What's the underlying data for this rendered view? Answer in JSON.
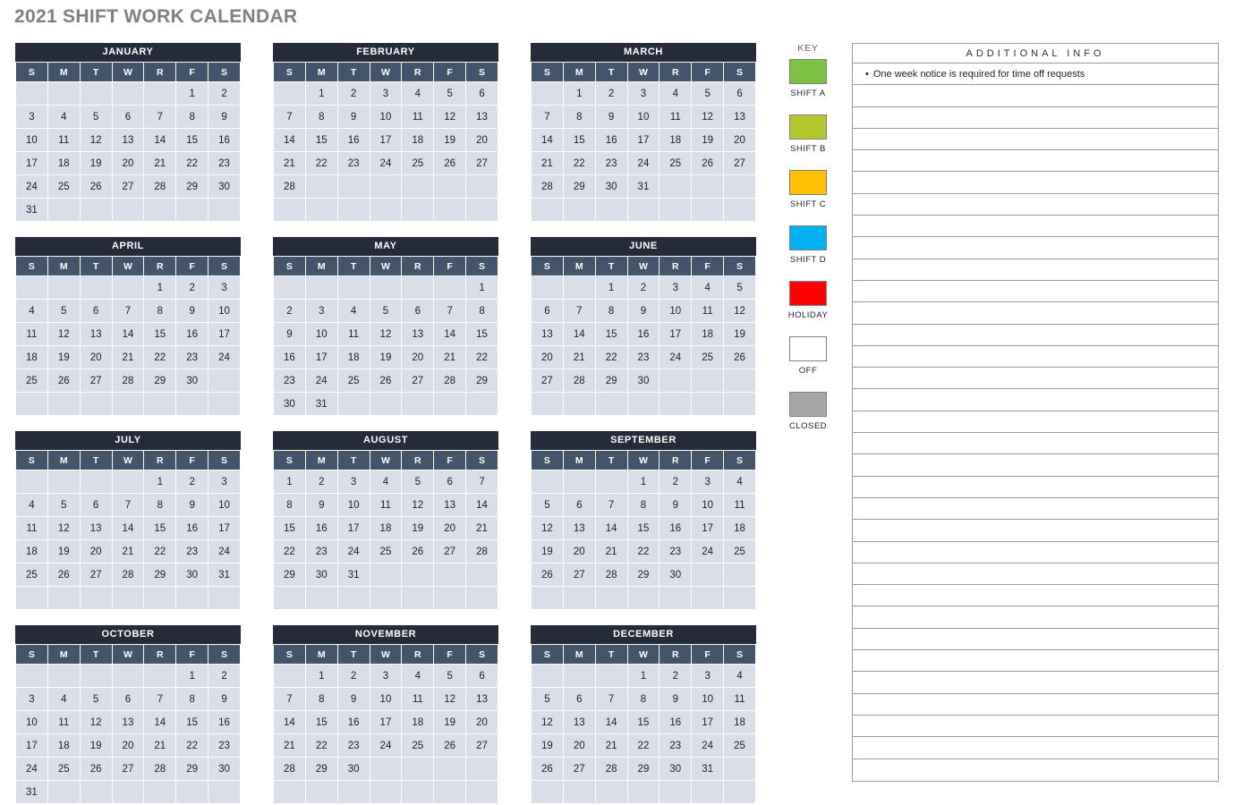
{
  "title": "2021 SHIFT WORK CALENDAR",
  "weekday_headers": [
    "S",
    "M",
    "T",
    "W",
    "R",
    "F",
    "S"
  ],
  "colors": {
    "month_title_bg": "#262b3a",
    "weekday_bg": "#44546a",
    "day_cell_bg": "#d9dee8",
    "title_text": "#808080"
  },
  "months": [
    {
      "name": "JANUARY",
      "weeks": [
        [
          "",
          "",
          "",
          "",
          "",
          "1",
          "2"
        ],
        [
          "3",
          "4",
          "5",
          "6",
          "7",
          "8",
          "9"
        ],
        [
          "10",
          "11",
          "12",
          "13",
          "14",
          "15",
          "16"
        ],
        [
          "17",
          "18",
          "19",
          "20",
          "21",
          "22",
          "23"
        ],
        [
          "24",
          "25",
          "26",
          "27",
          "28",
          "29",
          "30"
        ],
        [
          "31",
          "",
          "",
          "",
          "",
          "",
          ""
        ]
      ]
    },
    {
      "name": "FEBRUARY",
      "weeks": [
        [
          "",
          "1",
          "2",
          "3",
          "4",
          "5",
          "6"
        ],
        [
          "7",
          "8",
          "9",
          "10",
          "11",
          "12",
          "13"
        ],
        [
          "14",
          "15",
          "16",
          "17",
          "18",
          "19",
          "20"
        ],
        [
          "21",
          "22",
          "23",
          "24",
          "25",
          "26",
          "27"
        ],
        [
          "28",
          "",
          "",
          "",
          "",
          "",
          ""
        ],
        [
          "",
          "",
          "",
          "",
          "",
          "",
          ""
        ]
      ]
    },
    {
      "name": "MARCH",
      "weeks": [
        [
          "",
          "1",
          "2",
          "3",
          "4",
          "5",
          "6"
        ],
        [
          "7",
          "8",
          "9",
          "10",
          "11",
          "12",
          "13"
        ],
        [
          "14",
          "15",
          "16",
          "17",
          "18",
          "19",
          "20"
        ],
        [
          "21",
          "22",
          "23",
          "24",
          "25",
          "26",
          "27"
        ],
        [
          "28",
          "29",
          "30",
          "31",
          "",
          "",
          ""
        ],
        [
          "",
          "",
          "",
          "",
          "",
          "",
          ""
        ]
      ]
    },
    {
      "name": "APRIL",
      "weeks": [
        [
          "",
          "",
          "",
          "",
          "1",
          "2",
          "3"
        ],
        [
          "4",
          "5",
          "6",
          "7",
          "8",
          "9",
          "10"
        ],
        [
          "11",
          "12",
          "13",
          "14",
          "15",
          "16",
          "17"
        ],
        [
          "18",
          "19",
          "20",
          "21",
          "22",
          "23",
          "24"
        ],
        [
          "25",
          "26",
          "27",
          "28",
          "29",
          "30",
          ""
        ],
        [
          "",
          "",
          "",
          "",
          "",
          "",
          ""
        ]
      ]
    },
    {
      "name": "MAY",
      "weeks": [
        [
          "",
          "",
          "",
          "",
          "",
          "",
          "1"
        ],
        [
          "2",
          "3",
          "4",
          "5",
          "6",
          "7",
          "8"
        ],
        [
          "9",
          "10",
          "11",
          "12",
          "13",
          "14",
          "15"
        ],
        [
          "16",
          "17",
          "18",
          "19",
          "20",
          "21",
          "22"
        ],
        [
          "23",
          "24",
          "25",
          "26",
          "27",
          "28",
          "29"
        ],
        [
          "30",
          "31",
          "",
          "",
          "",
          "",
          ""
        ]
      ]
    },
    {
      "name": "JUNE",
      "weeks": [
        [
          "",
          "",
          "1",
          "2",
          "3",
          "4",
          "5"
        ],
        [
          "6",
          "7",
          "8",
          "9",
          "10",
          "11",
          "12"
        ],
        [
          "13",
          "14",
          "15",
          "16",
          "17",
          "18",
          "19"
        ],
        [
          "20",
          "21",
          "22",
          "23",
          "24",
          "25",
          "26"
        ],
        [
          "27",
          "28",
          "29",
          "30",
          "",
          "",
          ""
        ],
        [
          "",
          "",
          "",
          "",
          "",
          "",
          ""
        ]
      ]
    },
    {
      "name": "JULY",
      "weeks": [
        [
          "",
          "",
          "",
          "",
          "1",
          "2",
          "3"
        ],
        [
          "4",
          "5",
          "6",
          "7",
          "8",
          "9",
          "10"
        ],
        [
          "11",
          "12",
          "13",
          "14",
          "15",
          "16",
          "17"
        ],
        [
          "18",
          "19",
          "20",
          "21",
          "22",
          "23",
          "24"
        ],
        [
          "25",
          "26",
          "27",
          "28",
          "29",
          "30",
          "31"
        ],
        [
          "",
          "",
          "",
          "",
          "",
          "",
          ""
        ]
      ]
    },
    {
      "name": "AUGUST",
      "weeks": [
        [
          "1",
          "2",
          "3",
          "4",
          "5",
          "6",
          "7"
        ],
        [
          "8",
          "9",
          "10",
          "11",
          "12",
          "13",
          "14"
        ],
        [
          "15",
          "16",
          "17",
          "18",
          "19",
          "20",
          "21"
        ],
        [
          "22",
          "23",
          "24",
          "25",
          "26",
          "27",
          "28"
        ],
        [
          "29",
          "30",
          "31",
          "",
          "",
          "",
          ""
        ],
        [
          "",
          "",
          "",
          "",
          "",
          "",
          ""
        ]
      ]
    },
    {
      "name": "SEPTEMBER",
      "weeks": [
        [
          "",
          "",
          "",
          "1",
          "2",
          "3",
          "4"
        ],
        [
          "5",
          "6",
          "7",
          "8",
          "9",
          "10",
          "11"
        ],
        [
          "12",
          "13",
          "14",
          "15",
          "16",
          "17",
          "18"
        ],
        [
          "19",
          "20",
          "21",
          "22",
          "23",
          "24",
          "25"
        ],
        [
          "26",
          "27",
          "28",
          "29",
          "30",
          "",
          ""
        ],
        [
          "",
          "",
          "",
          "",
          "",
          "",
          ""
        ]
      ]
    },
    {
      "name": "OCTOBER",
      "weeks": [
        [
          "",
          "",
          "",
          "",
          "",
          "1",
          "2"
        ],
        [
          "3",
          "4",
          "5",
          "6",
          "7",
          "8",
          "9"
        ],
        [
          "10",
          "11",
          "12",
          "13",
          "14",
          "15",
          "16"
        ],
        [
          "17",
          "18",
          "19",
          "20",
          "21",
          "22",
          "23"
        ],
        [
          "24",
          "25",
          "26",
          "27",
          "28",
          "29",
          "30"
        ],
        [
          "31",
          "",
          "",
          "",
          "",
          "",
          ""
        ]
      ]
    },
    {
      "name": "NOVEMBER",
      "weeks": [
        [
          "",
          "1",
          "2",
          "3",
          "4",
          "5",
          "6"
        ],
        [
          "7",
          "8",
          "9",
          "10",
          "11",
          "12",
          "13"
        ],
        [
          "14",
          "15",
          "16",
          "17",
          "18",
          "19",
          "20"
        ],
        [
          "21",
          "22",
          "23",
          "24",
          "25",
          "26",
          "27"
        ],
        [
          "28",
          "29",
          "30",
          "",
          "",
          "",
          ""
        ],
        [
          "",
          "",
          "",
          "",
          "",
          "",
          ""
        ]
      ]
    },
    {
      "name": "DECEMBER",
      "weeks": [
        [
          "",
          "",
          "",
          "1",
          "2",
          "3",
          "4"
        ],
        [
          "5",
          "6",
          "7",
          "8",
          "9",
          "10",
          "11"
        ],
        [
          "12",
          "13",
          "14",
          "15",
          "16",
          "17",
          "18"
        ],
        [
          "19",
          "20",
          "21",
          "22",
          "23",
          "24",
          "25"
        ],
        [
          "26",
          "27",
          "28",
          "29",
          "30",
          "31",
          ""
        ],
        [
          "",
          "",
          "",
          "",
          "",
          "",
          ""
        ]
      ]
    }
  ],
  "key": {
    "heading": "KEY",
    "items": [
      {
        "label": "SHIFT A",
        "color": "#7dc242"
      },
      {
        "label": "SHIFT B",
        "color": "#b5c72e"
      },
      {
        "label": "SHIFT C",
        "color": "#ffc000"
      },
      {
        "label": "SHIFT D",
        "color": "#00b0f0"
      },
      {
        "label": "HOLIDAY",
        "color": "#ff0000"
      },
      {
        "label": "OFF",
        "color": "#ffffff"
      },
      {
        "label": "CLOSED",
        "color": "#a6a6a6"
      }
    ]
  },
  "additional_info": {
    "header": "ADDITIONAL INFO",
    "rows": [
      "One week notice is required for time off requests",
      "",
      "",
      "",
      "",
      "",
      "",
      "",
      "",
      "",
      "",
      "",
      "",
      "",
      "",
      "",
      "",
      "",
      "",
      "",
      "",
      "",
      "",
      "",
      "",
      "",
      "",
      "",
      "",
      "",
      "",
      "",
      ""
    ]
  }
}
